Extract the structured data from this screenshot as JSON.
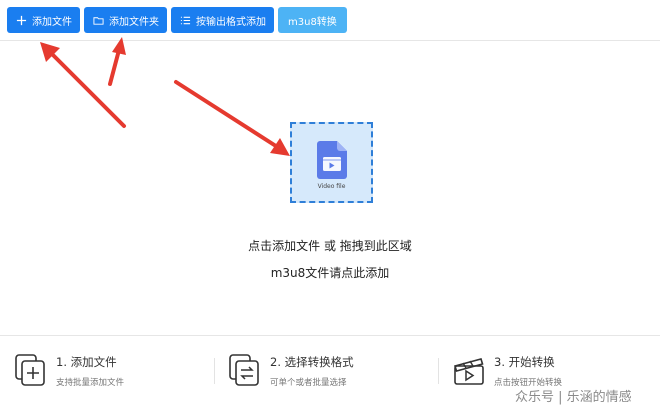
{
  "toolbar": {
    "add_file": "添加文件",
    "add_folder": "添加文件夹",
    "add_by_format": "按输出格式添加",
    "m3u8": "m3u8转换"
  },
  "dropzone": {
    "file_label": "Video file"
  },
  "hints": {
    "line1": "点击添加文件 或 拖拽到此区域",
    "line2": "m3u8文件请点此添加"
  },
  "steps": [
    {
      "title": "1. 添加文件",
      "desc": "支持批量添加文件"
    },
    {
      "title": "2. 选择转换格式",
      "desc": "可单个或者批量选择"
    },
    {
      "title": "3. 开始转换",
      "desc": "点击按钮开始转换"
    }
  ],
  "watermark": "众乐号 | 乐涵的情感",
  "colors": {
    "primary": "#1a7ef0",
    "light_button": "#4db3f5",
    "dropzone_bg": "#d6e9fb",
    "annotation_arrow": "#e53a2f"
  }
}
